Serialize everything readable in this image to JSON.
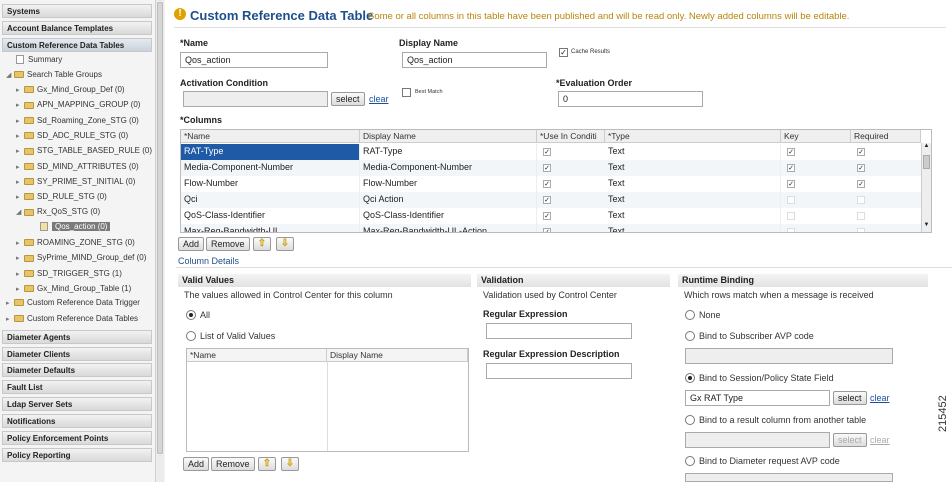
{
  "sidebar": {
    "headers": [
      "Systems",
      "Account Balance Templates",
      "Custom Reference Data Tables",
      "Diameter Agents",
      "Diameter Clients",
      "Diameter Defaults",
      "Fault List",
      "Ldap Server Sets",
      "Notifications",
      "Policy Enforcement Points",
      "Policy Reporting"
    ],
    "tree": {
      "summary": "Summary",
      "search_table_groups": "Search Table Groups",
      "groups": [
        "Gx_Mind_Group_Def (0)",
        "APN_MAPPING_GROUP (0)",
        "Sd_Roaming_Zone_STG (0)",
        "SD_ADC_RULE_STG (0)",
        "STG_TABLE_BASED_RULE (0)",
        "SD_MIND_ATTRIBUTES (0)",
        "SY_PRIME_ST_INITIAL (0)",
        "SD_RULE_STG (0)",
        "Rx_QoS_STG (0)"
      ],
      "selected_child": "Qos_action (0)",
      "groups2": [
        "ROAMING_ZONE_STG (0)",
        "SyPrime_MIND_Group_def (0)",
        "SD_TRIGGER_STG (1)",
        "Gx_Mind_Group_Table (1)"
      ],
      "trigger": "Custom Reference Data Trigger",
      "tables": "Custom Reference Data Tables"
    }
  },
  "header": {
    "title": "Custom Reference Data Table",
    "note": "Some or all columns in this table have been published and will be read only. Newly added columns will be editable."
  },
  "form": {
    "name_label": "*Name",
    "name_value": "Qos_action",
    "display_label": "Display Name",
    "display_value": "Qos_action",
    "cache_label": "Cache Results",
    "activation_label": "Activation Condition",
    "select": "select",
    "clear": "clear",
    "best_match_label": "Best Match",
    "eval_label": "*Evaluation Order",
    "eval_value": "0",
    "columns_label": "*Columns"
  },
  "grid": {
    "headers": [
      "*Name",
      "Display Name",
      "*Use In Conditi",
      "*Type",
      "Key",
      "Required"
    ],
    "rows": [
      {
        "name": "RAT-Type",
        "display": "RAT-Type",
        "type": "Text",
        "use": true,
        "key": true,
        "req": true
      },
      {
        "name": "Media-Component-Number",
        "display": "Media-Component-Number",
        "type": "Text",
        "use": true,
        "key": true,
        "req": true
      },
      {
        "name": "Flow-Number",
        "display": "Flow-Number",
        "type": "Text",
        "use": true,
        "key": true,
        "req": true
      },
      {
        "name": "Qci",
        "display": "Qci Action",
        "type": "Text",
        "use": true,
        "key": false,
        "req": false
      },
      {
        "name": "QoS-Class-Identifier",
        "display": "QoS-Class-Identifier",
        "type": "Text",
        "use": true,
        "key": false,
        "req": false
      },
      {
        "name": "Max-Req-Bandwidth-UL",
        "display": "Max-Req-Bandwidth-UL-Action",
        "type": "Text",
        "use": true,
        "key": false,
        "req": false
      }
    ]
  },
  "buttons": {
    "add": "Add",
    "remove": "Remove"
  },
  "details": {
    "title": "Column Details",
    "valid_values": "Valid Values",
    "valid_desc": "The values allowed in Control Center for this column",
    "all": "All",
    "list": "List of Valid Values",
    "vv_headers": [
      "*Name",
      "Display Name"
    ],
    "validation": "Validation",
    "validation_desc": "Validation used by Control Center",
    "regex": "Regular Expression",
    "regex_desc": "Regular Expression Description",
    "runtime": "Runtime Binding",
    "runtime_desc": "Which rows match when a message is received",
    "none": "None",
    "subscriber_avp": "Bind to Subscriber AVP code",
    "session_field": "Bind to Session/Policy State Field",
    "session_value": "Gx RAT Type",
    "result_col": "Bind to a result column from another table",
    "diameter_avp": "Bind to Diameter request AVP code"
  },
  "figure_number": "215452"
}
